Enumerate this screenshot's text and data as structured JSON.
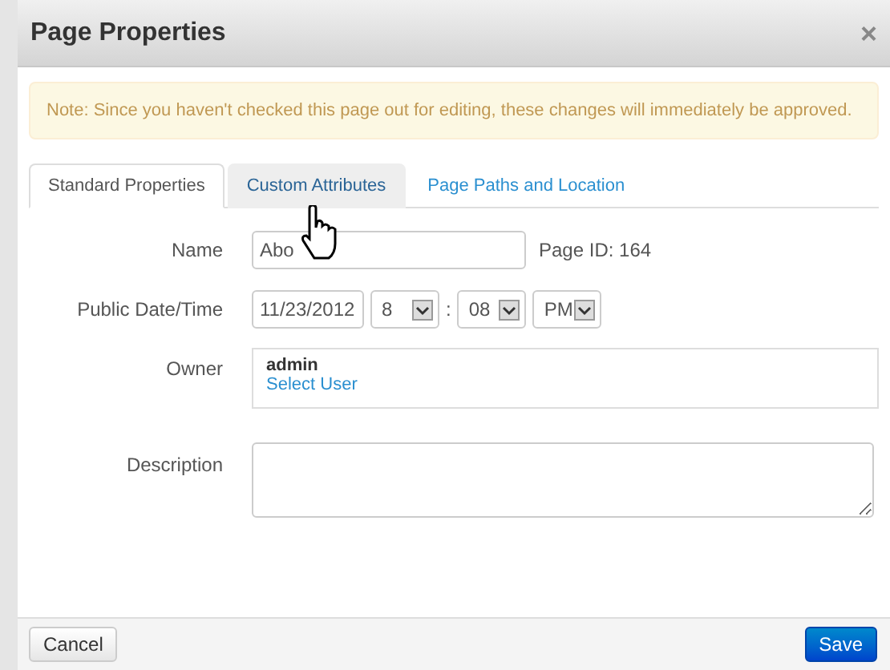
{
  "dialog": {
    "title": "Page Properties",
    "close": "×"
  },
  "alert": "Note: Since you haven't checked this page out for editing, these changes will immediately be approved.",
  "tabs": [
    {
      "label": "Standard Properties",
      "selected": true,
      "hovered": false
    },
    {
      "label": "Custom Attributes",
      "selected": false,
      "hovered": true
    },
    {
      "label": "Page Paths and Location",
      "selected": false,
      "hovered": false
    }
  ],
  "form": {
    "name": {
      "label": "Name",
      "value": "Abo",
      "page_id": "Page ID: 164"
    },
    "date_time": {
      "label": "Public Date/Time",
      "date": "11/23/2012",
      "hour": "8",
      "separator": ":",
      "minute": "08",
      "ampm": "PM"
    },
    "owner": {
      "label": "Owner",
      "user": "admin",
      "link": "Select User"
    },
    "description": {
      "label": "Description"
    }
  },
  "buttons": [
    {
      "label": "Cancel",
      "kind": "default"
    },
    {
      "label": "Save",
      "kind": "primary"
    }
  ]
}
